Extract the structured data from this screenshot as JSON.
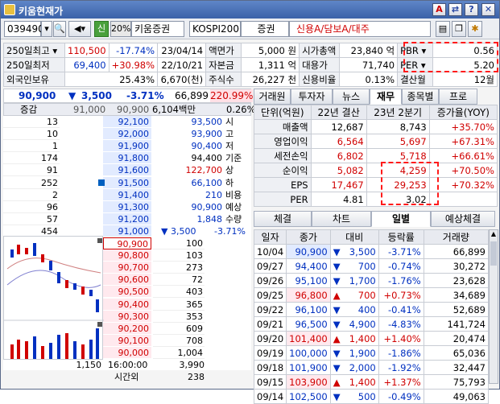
{
  "window": {
    "title": "키움현재가"
  },
  "toolbar": {
    "code": "039490",
    "flag": "신",
    "margin": "20%",
    "name": "키움증권",
    "market": "KOSPI200",
    "sector": "증권",
    "credit": "신용A/담보A/대주"
  },
  "info": {
    "row1": {
      "label": "250일최고",
      "price": "110,500",
      "rate": "-17.74%",
      "date": "23/04/14",
      "k1": "액면가",
      "v1": "5,000 원",
      "k2": "시가총액",
      "v2": "23,840 억",
      "k3": "PBR",
      "v3": "0.56"
    },
    "row2": {
      "label": "250일최저",
      "price": "69,400",
      "rate": "+30.98%",
      "date": "22/10/21",
      "k1": "자본금",
      "v1": "1,311 억",
      "k2": "대용가",
      "v2": "71,740",
      "k3": "PER",
      "v3": "5.20"
    },
    "row3": {
      "label": "외국인보유",
      "rate": "25.43%",
      "qty": "6,670(천)",
      "k1": "주식수",
      "v1": "26,227 천",
      "k2": "신용비율",
      "v2": "0.13%",
      "k3": "결산월",
      "v3": "12월"
    }
  },
  "quote": {
    "price": "90,900",
    "change": "3,500",
    "rate": "-3.71%",
    "volume": "66,899",
    "ratio": "220.99%",
    "amount": "6,104백만",
    "turnover": "0.26%",
    "label_diff": "증감"
  },
  "orderbook": {
    "asks": [
      {
        "qty": "13",
        "price": "92,100"
      },
      {
        "qty": "10",
        "price": "92,000"
      },
      {
        "qty": "1",
        "price": "91,900"
      },
      {
        "qty": "174",
        "price": "91,800"
      },
      {
        "qty": "91",
        "price": "91,600"
      },
      {
        "qty": "252",
        "price": "91,500"
      },
      {
        "qty": "2",
        "price": "91,400"
      },
      {
        "qty": "96",
        "price": "91,300"
      },
      {
        "qty": "57",
        "price": "91,200"
      },
      {
        "qty": "454",
        "price": "91,000"
      }
    ],
    "ask_top_qty": "91,000",
    "ask_top_price": "90,900",
    "summary": [
      {
        "v": "93,500",
        "k": "시"
      },
      {
        "v": "93,900",
        "k": "고"
      },
      {
        "v": "90,400",
        "k": "저"
      },
      {
        "v": "94,400",
        "k": "기준"
      },
      {
        "v": "122,700",
        "k": "상"
      },
      {
        "v": "66,100",
        "k": "하"
      },
      {
        "v": "210",
        "k": "비용"
      },
      {
        "v": "90,900",
        "k": "예상"
      },
      {
        "v": "1,848",
        "k": "수량"
      }
    ],
    "exp_change": "▼ 3,500",
    "exp_rate": "-3.71%",
    "bids": [
      {
        "price": "90,900",
        "qty": "100"
      },
      {
        "price": "90,800",
        "qty": "103"
      },
      {
        "price": "90,700",
        "qty": "273"
      },
      {
        "price": "90,600",
        "qty": "72"
      },
      {
        "price": "90,500",
        "qty": "403"
      },
      {
        "price": "90,400",
        "qty": "365"
      },
      {
        "price": "90,300",
        "qty": "353"
      },
      {
        "price": "90,200",
        "qty": "609"
      },
      {
        "price": "90,100",
        "qty": "708"
      },
      {
        "price": "90,000",
        "qty": "1,004"
      }
    ],
    "total_left": "1,150",
    "time": "16:00:00",
    "total_right": "3,990",
    "after_label": "시간외",
    "after_qty": "238"
  },
  "tabs1": [
    "거래원",
    "투자자",
    "뉴스",
    "재무",
    "종목별",
    "프로"
  ],
  "finance": {
    "headers": [
      "단위(억원)",
      "22년 결산",
      "23년 2분기",
      "증가율(YOY)"
    ],
    "rows": [
      {
        "k": "매출액",
        "a": "12,687",
        "b": "8,743",
        "c": "+35.70%"
      },
      {
        "k": "영업이익",
        "a": "6,564",
        "b": "5,697",
        "c": "+67.31%"
      },
      {
        "k": "세전손익",
        "a": "6,802",
        "b": "5,718",
        "c": "+66.61%"
      },
      {
        "k": "순이익",
        "a": "5,082",
        "b": "4,259",
        "c": "+70.50%"
      },
      {
        "k": "EPS",
        "a": "17,467",
        "b": "29,253",
        "c": "+70.32%"
      },
      {
        "k": "PER",
        "a": "4.81",
        "b": "3.02",
        "c": ""
      }
    ]
  },
  "tabs2": [
    "체결",
    "차트",
    "일별",
    "예상체결"
  ],
  "daily": {
    "headers": [
      "일자",
      "종가",
      "대비",
      "등락률",
      "거래량"
    ],
    "rows": [
      {
        "d": "10/04",
        "p": "90,900",
        "s": "▼",
        "c": "3,500",
        "r": "-3.71%",
        "v": "66,899",
        "dir": "dn"
      },
      {
        "d": "09/27",
        "p": "94,400",
        "s": "▼",
        "c": "700",
        "r": "-0.74%",
        "v": "30,272",
        "dir": "dn"
      },
      {
        "d": "09/26",
        "p": "95,100",
        "s": "▼",
        "c": "1,700",
        "r": "-1.76%",
        "v": "23,628",
        "dir": "dn"
      },
      {
        "d": "09/25",
        "p": "96,800",
        "s": "▲",
        "c": "700",
        "r": "+0.73%",
        "v": "34,689",
        "dir": "up"
      },
      {
        "d": "09/22",
        "p": "96,100",
        "s": "▼",
        "c": "400",
        "r": "-0.41%",
        "v": "52,689",
        "dir": "dn"
      },
      {
        "d": "09/21",
        "p": "96,500",
        "s": "▼",
        "c": "4,900",
        "r": "-4.83%",
        "v": "141,724",
        "dir": "dn"
      },
      {
        "d": "09/20",
        "p": "101,400",
        "s": "▲",
        "c": "1,400",
        "r": "+1.40%",
        "v": "20,474",
        "dir": "up"
      },
      {
        "d": "09/19",
        "p": "100,000",
        "s": "▼",
        "c": "1,900",
        "r": "-1.86%",
        "v": "65,036",
        "dir": "dn"
      },
      {
        "d": "09/18",
        "p": "101,900",
        "s": "▼",
        "c": "2,000",
        "r": "-1.92%",
        "v": "32,447",
        "dir": "dn"
      },
      {
        "d": "09/15",
        "p": "103,900",
        "s": "▲",
        "c": "1,400",
        "r": "+1.37%",
        "v": "75,793",
        "dir": "up"
      },
      {
        "d": "09/14",
        "p": "102,500",
        "s": "▼",
        "c": "500",
        "r": "-0.49%",
        "v": "49,063",
        "dir": "dn"
      }
    ]
  },
  "colors": {
    "up": "#d00000",
    "down": "#0030c0",
    "highlight": "#ff1a1a"
  }
}
